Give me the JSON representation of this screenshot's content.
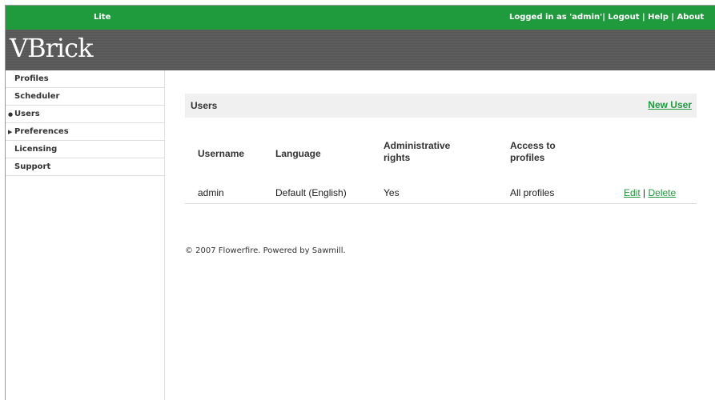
{
  "topbar": {
    "edition": "Lite",
    "logged_in": "Logged in as 'admin'",
    "sep1": "|",
    "logout": "Logout",
    "sep2": "|",
    "help": "Help",
    "sep3": "|",
    "about": "About"
  },
  "brand": {
    "logo": "VBrick"
  },
  "sidebar": {
    "items": [
      {
        "label": "Profiles",
        "marker": ""
      },
      {
        "label": "Scheduler",
        "marker": ""
      },
      {
        "label": "Users",
        "marker": "●"
      },
      {
        "label": "Preferences",
        "marker": "▶"
      },
      {
        "label": "Licensing",
        "marker": ""
      },
      {
        "label": "Support",
        "marker": ""
      }
    ]
  },
  "main": {
    "section_title": "Users",
    "new_user": "New User",
    "columns": [
      "Username",
      "Language",
      "Administrative rights",
      "Access to profiles"
    ],
    "rows": [
      {
        "username": "admin",
        "language": "Default (English)",
        "admin_rights": "Yes",
        "access": "All profiles",
        "edit": "Edit",
        "sep": "|",
        "delete": "Delete"
      }
    ]
  },
  "footer": "© 2007 Flowerfire. Powered by Sawmill.",
  "colors": {
    "accent": "#1f9a3c",
    "brandbar": "#5a5a5a"
  }
}
